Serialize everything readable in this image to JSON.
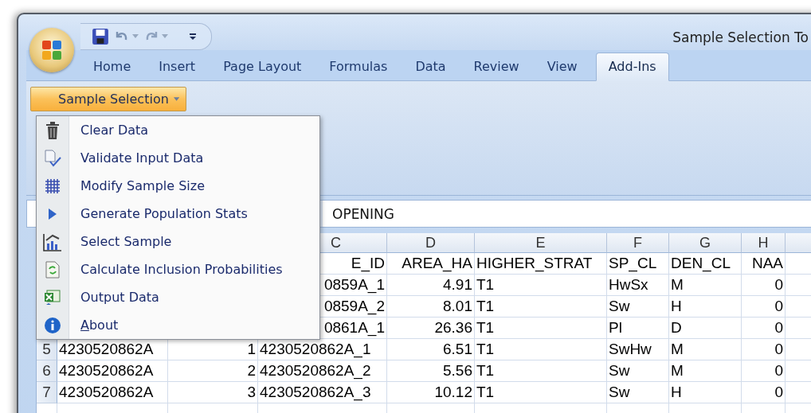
{
  "window": {
    "title": "Sample Selection To"
  },
  "tabs": [
    {
      "label": "Home",
      "selected": false
    },
    {
      "label": "Insert",
      "selected": false
    },
    {
      "label": "Page Layout",
      "selected": false
    },
    {
      "label": "Formulas",
      "selected": false
    },
    {
      "label": "Data",
      "selected": false
    },
    {
      "label": "Review",
      "selected": false
    },
    {
      "label": "View",
      "selected": false
    },
    {
      "label": "Add-Ins",
      "selected": true
    }
  ],
  "ribbon": {
    "button": {
      "label": "Sample Selection",
      "expanded": true
    }
  },
  "menu": {
    "items": [
      {
        "label": "Clear Data",
        "kind": "trash",
        "mnemonic": false
      },
      {
        "label": "Validate Input Data",
        "kind": "validate",
        "mnemonic": false
      },
      {
        "label": "Modify Sample Size",
        "kind": "grid",
        "mnemonic": false
      },
      {
        "label": "Generate Population Stats",
        "kind": "play",
        "mnemonic": false
      },
      {
        "label": "Select Sample",
        "kind": "chart",
        "mnemonic": false
      },
      {
        "label": "Calculate Inclusion Probabilities",
        "kind": "refresh",
        "mnemonic": false
      },
      {
        "label": "Output Data",
        "kind": "excel",
        "mnemonic": false
      },
      {
        "label": "About",
        "kind": "info",
        "mnemonic": true
      }
    ]
  },
  "formula_bar": {
    "value": "OPENING"
  },
  "sheet": {
    "columns": [
      "",
      "",
      "C",
      "D",
      "E",
      "F",
      "G",
      "H"
    ],
    "rows": [
      {
        "cells": [
          null,
          null,
          "E_ID",
          "AREA_HA",
          "HIGHER_STRAT",
          "SP_CL",
          "DEN_CL",
          "NAA"
        ]
      },
      {
        "cells": [
          null,
          null,
          "0859A_1",
          "4.91",
          "T1",
          "HwSx",
          "M",
          "0"
        ]
      },
      {
        "cells": [
          null,
          null,
          "0859A_2",
          "8.01",
          "T1",
          "Sw",
          "H",
          "0"
        ]
      },
      {
        "cells": [
          null,
          null,
          "0861A_1",
          "26.36",
          "T1",
          "Pl",
          "D",
          "0"
        ]
      },
      {
        "number": "5",
        "cells": [
          "4230520862A",
          "1",
          "4230520862A_1",
          "6.51",
          "T1",
          "SwHw",
          "M",
          "0"
        ]
      },
      {
        "number": "6",
        "cells": [
          "4230520862A",
          "2",
          "4230520862A_2",
          "5.56",
          "T1",
          "Sw",
          "M",
          "0"
        ]
      },
      {
        "number": "7",
        "cells": [
          "4230520862A",
          "3",
          "4230520862A_3",
          "10.12",
          "T1",
          "Sw",
          "H",
          "0"
        ]
      }
    ]
  }
}
